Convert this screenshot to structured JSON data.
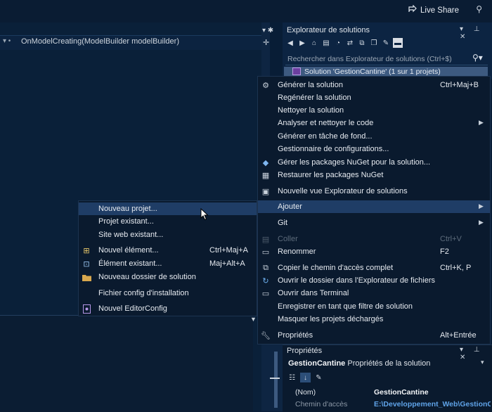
{
  "topbar": {
    "live_share": "Live Share"
  },
  "editor": {
    "method": "OnModelCreating(ModelBuilder modelBuilder)"
  },
  "solution_explorer": {
    "title": "Explorateur de solutions",
    "search_placeholder": "Rechercher dans Explorateur de solutions (Ctrl+$)",
    "selected_item": "Solution 'GestionCantine' (1 sur 1 projets)"
  },
  "context_menu": {
    "items": [
      {
        "label": "Générer la solution",
        "shortcut": "Ctrl+Maj+B",
        "icon": "build-icon"
      },
      {
        "label": "Regénérer la solution",
        "shortcut": "",
        "icon": ""
      },
      {
        "label": "Nettoyer la solution",
        "shortcut": "",
        "icon": ""
      },
      {
        "label": "Analyser et nettoyer le code",
        "shortcut": "",
        "icon": "",
        "submenu": true
      },
      {
        "label": "Générer en tâche de fond...",
        "shortcut": "",
        "icon": ""
      },
      {
        "label": "Gestionnaire de configurations...",
        "shortcut": "",
        "icon": ""
      },
      {
        "label": "Gérer les packages NuGet pour la solution...",
        "shortcut": "",
        "icon": "nuget-icon"
      },
      {
        "label": "Restaurer les packages NuGet",
        "shortcut": "",
        "icon": "restore-icon"
      },
      {
        "label": "Nouvelle vue Explorateur de solutions",
        "shortcut": "",
        "icon": "new-view-icon"
      },
      {
        "label": "Ajouter",
        "shortcut": "",
        "icon": "",
        "submenu": true
      },
      {
        "label": "Git",
        "shortcut": "",
        "icon": "",
        "submenu": true
      },
      {
        "label": "Coller",
        "shortcut": "Ctrl+V",
        "icon": "paste-icon",
        "disabled": true
      },
      {
        "label": "Renommer",
        "shortcut": "F2",
        "icon": "rename-icon"
      },
      {
        "label": "Copier le chemin d'accès complet",
        "shortcut": "Ctrl+K, P",
        "icon": "copy-icon"
      },
      {
        "label": "Ouvrir le dossier dans l'Explorateur de fichiers",
        "shortcut": "",
        "icon": "refresh-icon"
      },
      {
        "label": "Ouvrir dans Terminal",
        "shortcut": "",
        "icon": "terminal-icon"
      },
      {
        "label": "Enregistrer en tant que filtre de solution",
        "shortcut": "",
        "icon": ""
      },
      {
        "label": "Masquer les projets déchargés",
        "shortcut": "",
        "icon": ""
      },
      {
        "label": "Propriétés",
        "shortcut": "Alt+Entrée",
        "icon": "wrench-icon"
      }
    ]
  },
  "submenu": {
    "items": [
      {
        "label": "Nouveau projet...",
        "shortcut": "",
        "icon": ""
      },
      {
        "label": "Projet existant...",
        "shortcut": "",
        "icon": ""
      },
      {
        "label": "Site web existant...",
        "shortcut": "",
        "icon": ""
      },
      {
        "label": "Nouvel élément...",
        "shortcut": "Ctrl+Maj+A",
        "icon": "new-item-icon"
      },
      {
        "label": "Élément existant...",
        "shortcut": "Maj+Alt+A",
        "icon": "existing-item-icon"
      },
      {
        "label": "Nouveau dossier de solution",
        "shortcut": "",
        "icon": "folder-icon"
      },
      {
        "label": "Fichier config d'installation",
        "shortcut": "",
        "icon": ""
      },
      {
        "label": "Nouvel EditorConfig",
        "shortcut": "",
        "icon": "editorconfig-icon"
      }
    ]
  },
  "properties": {
    "title": "Propriétés",
    "object_name": "GestionCantine",
    "object_type": "Propriétés de la solution",
    "rows": [
      {
        "key": "(Nom)",
        "value": "GestionCantine"
      },
      {
        "key": "Chemin d'accès",
        "value": "E:\\Developpement_Web\\GestionC"
      }
    ]
  }
}
